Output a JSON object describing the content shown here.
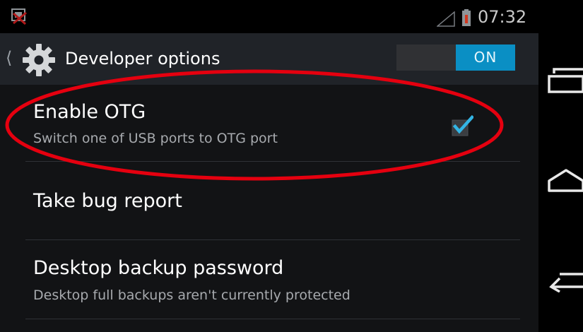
{
  "status_bar": {
    "time": "07:32",
    "icons": [
      "usb-debugging-notification-icon",
      "signal-icon",
      "battery-icon"
    ]
  },
  "action_bar": {
    "title": "Developer options",
    "switch_label": "ON",
    "icons": [
      "chevron-left-icon",
      "gear-icon"
    ]
  },
  "settings": {
    "items": [
      {
        "title": "Enable OTG",
        "summary": "Switch one of USB ports to OTG port",
        "checked": true
      },
      {
        "title": "Take bug report"
      },
      {
        "title": "Desktop backup password",
        "summary": "Desktop full backups aren't currently protected"
      }
    ]
  },
  "nav_bar": {
    "icons": [
      "recent-apps-icon",
      "home-icon",
      "back-icon"
    ]
  },
  "colors": {
    "accent": "#0a8fc4",
    "checkmark": "#33b5e5",
    "annotation": "#e5000f",
    "background": "#121315",
    "action_bar": "#202328"
  }
}
